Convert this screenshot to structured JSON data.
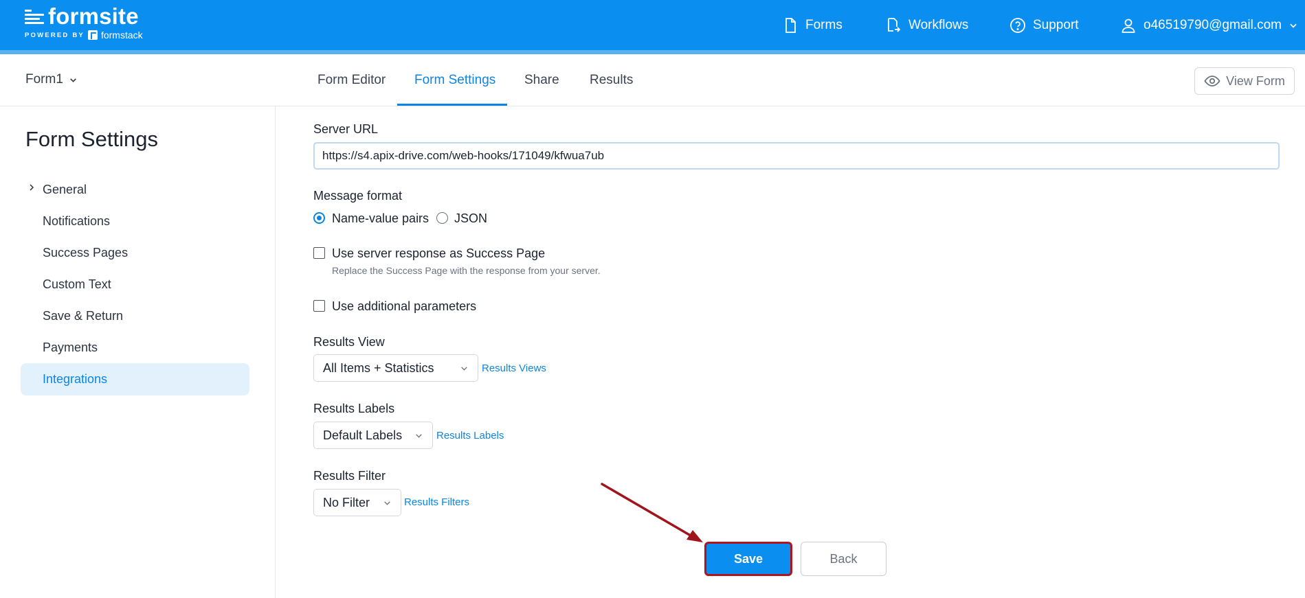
{
  "brand": {
    "name": "formsite",
    "powered_by": "POWERED BY",
    "partner": "formstack"
  },
  "topnav": {
    "forms": "Forms",
    "workflows": "Workflows",
    "support": "Support",
    "account": "o46519790@gmail.com"
  },
  "subheader": {
    "form_name": "Form1",
    "tabs": [
      "Form Editor",
      "Form Settings",
      "Share",
      "Results"
    ],
    "active_tab": "Form Settings",
    "view_form": "View Form"
  },
  "sidebar": {
    "title": "Form Settings",
    "items": [
      "General",
      "Notifications",
      "Success Pages",
      "Custom Text",
      "Save & Return",
      "Payments",
      "Integrations"
    ],
    "active_item": "Integrations"
  },
  "main": {
    "server_url_label": "Server URL",
    "server_url_value": "https://s4.apix-drive.com/web-hooks/171049/kfwua7ub",
    "message_format_label": "Message format",
    "message_format_options": [
      "Name-value pairs",
      "JSON"
    ],
    "message_format_selected": "Name-value pairs",
    "use_server_response_label": "Use server response as Success Page",
    "use_server_response_checked": false,
    "use_server_response_help": "Replace the Success Page with the response from your server.",
    "use_additional_params_label": "Use additional parameters",
    "use_additional_params_checked": false,
    "results_view_label": "Results View",
    "results_view_value": "All Items + Statistics",
    "results_view_link": "Results Views",
    "results_labels_label": "Results Labels",
    "results_labels_value": "Default Labels",
    "results_labels_link": "Results Labels",
    "results_filter_label": "Results Filter",
    "results_filter_value": "No Filter",
    "results_filter_link": "Results Filters",
    "save_label": "Save",
    "back_label": "Back"
  },
  "colors": {
    "brand_blue": "#0a8ef0",
    "link_blue": "#0a85e6",
    "highlight_red": "#b0141e"
  },
  "icons": {
    "forms": "document-icon",
    "workflows": "workflow-icon",
    "support": "help-circle-icon",
    "account": "user-icon",
    "view_form": "eye-icon"
  }
}
